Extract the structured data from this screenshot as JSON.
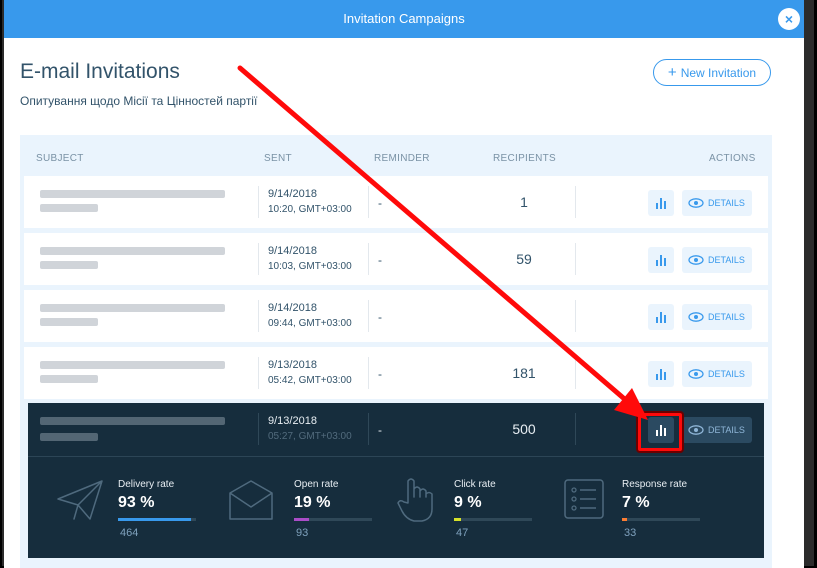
{
  "window": {
    "title": "Invitation Campaigns",
    "close_label": "×"
  },
  "header": {
    "title": "E-mail Invitations",
    "subtitle": "Опитування щодо Місії та Цінностей партії",
    "new_button": {
      "plus": "+",
      "label": "New Invitation"
    }
  },
  "table": {
    "columns": [
      "SUBJECT",
      "SENT",
      "REMINDER",
      "RECIPIENTS",
      "ACTIONS"
    ],
    "rows": [
      {
        "date": "9/14/2018",
        "time": "10:20, GMT+03:00",
        "reminder": "-",
        "recipients": "1"
      },
      {
        "date": "9/14/2018",
        "time": "10:03, GMT+03:00",
        "reminder": "-",
        "recipients": "59"
      },
      {
        "date": "9/14/2018",
        "time": "09:44, GMT+03:00",
        "reminder": "-",
        "recipients": ""
      },
      {
        "date": "9/13/2018",
        "time": "05:42, GMT+03:00",
        "reminder": "-",
        "recipients": "181"
      },
      {
        "date": "9/13/2018",
        "time": "05:27, GMT+03:00",
        "reminder": "-",
        "recipients": "500"
      }
    ],
    "details_label": "DETAILS"
  },
  "stats": [
    {
      "label": "Delivery rate",
      "value": "93 %",
      "count": "464",
      "fraction": 0.93,
      "color": "#3899ec",
      "icon": "paper-plane-icon"
    },
    {
      "label": "Open rate",
      "value": "19 %",
      "count": "93",
      "fraction": 0.19,
      "color": "#aa4dc8",
      "icon": "envelope-icon"
    },
    {
      "label": "Click rate",
      "value": "9 %",
      "count": "47",
      "fraction": 0.09,
      "color": "#d6e12a",
      "icon": "pointer-hand-icon"
    },
    {
      "label": "Response rate",
      "value": "7 %",
      "count": "33",
      "fraction": 0.07,
      "color": "#fb7d33",
      "icon": "list-icon"
    }
  ],
  "colors": {
    "accent": "#3899ec",
    "dark": "#162d3d",
    "annotation": "#ff0a0a"
  }
}
